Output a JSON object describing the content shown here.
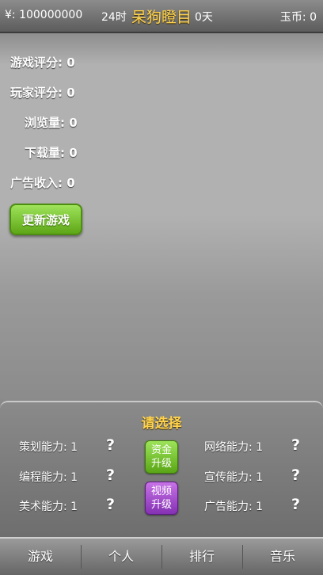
{
  "topbar": {
    "money": "¥: 100000000",
    "hour": "24时",
    "studio_name": "呆狗瞪目",
    "days": "0天",
    "jade": "玉币: 0"
  },
  "stats": [
    {
      "label": "游戏评分",
      "value": "0"
    },
    {
      "label": "玩家评分",
      "value": "0"
    },
    {
      "label": "浏览量",
      "value": "0"
    },
    {
      "label": "下载量",
      "value": "0"
    },
    {
      "label": "广告收入",
      "value": "0"
    }
  ],
  "stats_text": [
    "游戏评分: 0",
    "玩家评分: 0",
    "浏览量: 0",
    "下载量: 0",
    "广告收入: 0"
  ],
  "update_button": "更新游戏",
  "panel": {
    "title": "请选择",
    "skills_left": [
      "策划能力: 1",
      "编程能力: 1",
      "美术能力: 1"
    ],
    "skills_right": [
      "网络能力: 1",
      "宣传能力: 1",
      "广告能力: 1"
    ],
    "help_symbol": "?",
    "upgrade_funds": [
      "资金",
      "升级"
    ],
    "upgrade_video": [
      "视频",
      "升级"
    ]
  },
  "nav": {
    "tabs": [
      "游戏",
      "个人",
      "排行",
      "音乐"
    ]
  },
  "colors": {
    "accent_yellow": "#ffd34d",
    "button_green": "#6fbf22",
    "button_purple": "#9a45c8"
  }
}
